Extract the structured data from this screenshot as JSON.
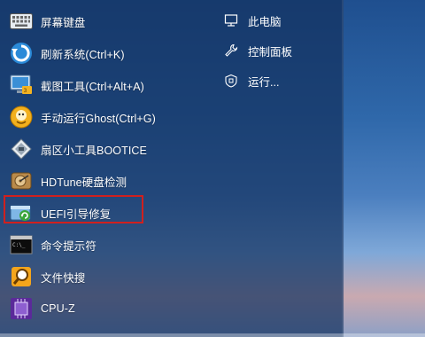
{
  "start_menu": {
    "items": [
      {
        "label": "屏幕键盘",
        "icon": "keyboard-icon"
      },
      {
        "label": "刷新系统(Ctrl+K)",
        "icon": "refresh-icon"
      },
      {
        "label": "截图工具(Ctrl+Alt+A)",
        "icon": "screenshot-icon"
      },
      {
        "label": "手动运行Ghost(Ctrl+G)",
        "icon": "ghost-icon"
      },
      {
        "label": "扇区小工具BOOTICE",
        "icon": "bootice-icon"
      },
      {
        "label": "HDTune硬盘检测",
        "icon": "hard-disk-icon"
      },
      {
        "label": "UEFI引导修复",
        "icon": "uefi-repair-icon"
      },
      {
        "label": "命令提示符",
        "icon": "command-prompt-icon"
      },
      {
        "label": "文件快搜",
        "icon": "file-search-icon"
      },
      {
        "label": "CPU-Z",
        "icon": "cpu-z-icon"
      }
    ],
    "highlighted_item": "UEFI引导修复",
    "right_links": [
      {
        "label": "此电脑",
        "icon": "computer-icon"
      },
      {
        "label": "控制面板",
        "icon": "wrench-icon"
      },
      {
        "label": "运行...",
        "icon": "run-icon"
      }
    ],
    "colors": {
      "highlight": "#d0201e",
      "menu_bg": "#14325f"
    }
  }
}
